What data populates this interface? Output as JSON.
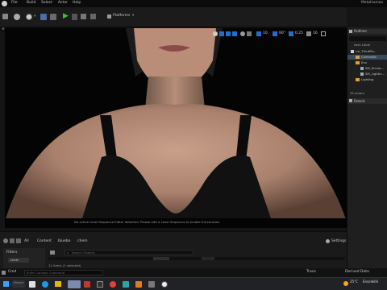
{
  "menu": {
    "items": [
      "File",
      "Build",
      "Select",
      "Actor",
      "Help"
    ],
    "project_name": "MetaHuman"
  },
  "toolbar": {
    "platforms_label": "Platforms"
  },
  "viewport": {
    "notice": "No active Level Sequence Editor detected. Please edit a Level Sequence to enable full controls.",
    "controls": {
      "camera_speed": "16",
      "fov": "90°",
      "grid": "10",
      "rotation": "0.25",
      "scale": "10"
    }
  },
  "outliner": {
    "title": "Outliner",
    "column_label": "Item Label",
    "rows": [
      "Lvl_ThirdPer...",
      "Cinematic",
      "Env",
      "SM_Enviro...",
      "SM_Lightin...",
      "Lighting"
    ],
    "actor_count": "25 actors"
  },
  "details": {
    "title": "Details"
  },
  "content_browser": {
    "breadcrumb": [
      "All",
      "Content",
      "bluebo",
      "chem"
    ],
    "settings_label": "Settings",
    "filters_label": "Filters",
    "filter_chip": "Level",
    "search_placeholder": "Search Objects",
    "items_count": "11 items (1 selected)"
  },
  "statusbar": {
    "cmd_label": "Cmd",
    "console_placeholder": "Enter Console Command",
    "trace_label": "Trace",
    "derived_data_label": "Derived Data"
  },
  "taskbar": {
    "search_placeholder": "Search",
    "temperature": "25°C",
    "weather_text": "Ensoleillé"
  },
  "colors": {
    "accent_green": "#3bbf3b",
    "accent_blue": "#1f6fd1",
    "folder_orange": "#d9a040",
    "notice_text": "#9a9a9a"
  }
}
